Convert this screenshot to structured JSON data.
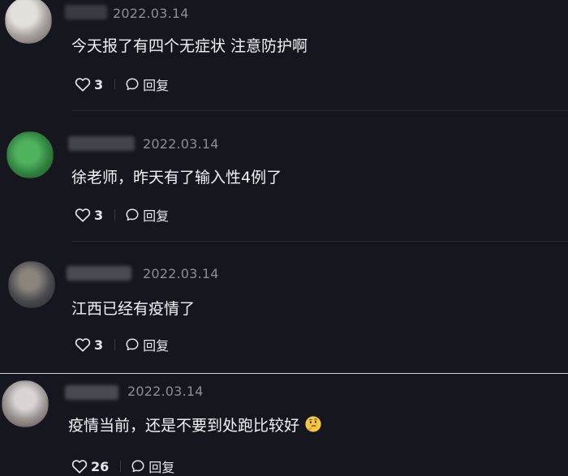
{
  "comments": [
    {
      "timestamp": "2022.03.14",
      "text": "今天报了有四个无症状 注意防护啊",
      "likes": "3",
      "reply_label": "回复",
      "avatar_colors": [
        "#d6d2cc",
        "#8f8a86"
      ]
    },
    {
      "timestamp": "2022.03.14",
      "text": "徐老师，昨天有了输入性4例了",
      "likes": "3",
      "reply_label": "回复",
      "avatar_colors": [
        "#3c9a4b",
        "#2c6d37"
      ]
    },
    {
      "timestamp": "2022.03.14",
      "text": "江西已经有疫情了",
      "likes": "3",
      "reply_label": "回复",
      "avatar_colors": [
        "#6f6a66",
        "#2e2f33"
      ]
    },
    {
      "timestamp": "2022.03.14",
      "text": "疫情当前，还是不要到处跑比较好",
      "likes": "26",
      "reply_label": "回复",
      "avatar_colors": [
        "#c8c3c2",
        "#6c6766"
      ],
      "emoji": "thinking-face-emoji"
    }
  ]
}
